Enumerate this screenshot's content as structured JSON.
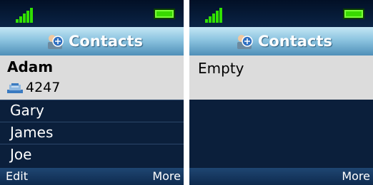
{
  "colors": {
    "list_background": "#0b1f3b",
    "selected_row": "#dcdcdc",
    "title_gradient_top": "#c4e6f4",
    "title_gradient_bottom": "#4f8fb8",
    "signal_green": "#31e000",
    "battery_green": "#39d900"
  },
  "screens": [
    {
      "status": {
        "signal_icon": "signal-bars-icon",
        "battery_icon": "battery-icon"
      },
      "title": {
        "icon": "contacts-icon",
        "text": "Contacts"
      },
      "selected_contact": {
        "name": "Adam",
        "phone_icon": "phone-icon",
        "number": "4247"
      },
      "contacts": [
        "Gary",
        "James",
        "Joe"
      ],
      "softkeys": {
        "left": "Edit",
        "right": "More"
      }
    },
    {
      "status": {
        "signal_icon": "signal-bars-icon",
        "battery_icon": "battery-icon"
      },
      "title": {
        "icon": "contacts-icon",
        "text": "Contacts"
      },
      "empty_message": "Empty",
      "softkeys": {
        "left": "",
        "right": "More"
      }
    }
  ]
}
